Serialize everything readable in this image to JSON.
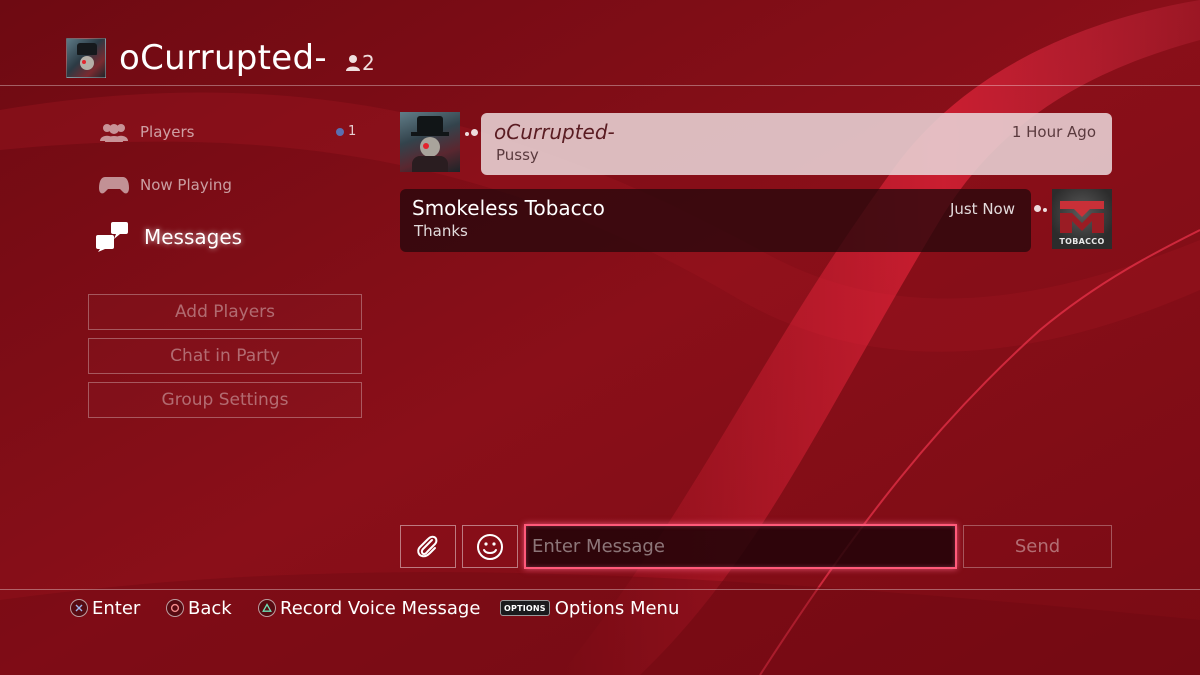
{
  "colors": {
    "background": "#7d0c15",
    "input_border": "#ff5a7a",
    "received_bubble": "#e8d4d6",
    "sent_bubble": "#26080b"
  },
  "header": {
    "title": "oCurrupted-",
    "member_count": "2",
    "member_icon": "person-icon"
  },
  "sidebar": {
    "items": [
      {
        "label": "Players",
        "icon": "players-icon",
        "badge": "1"
      },
      {
        "label": "Now Playing",
        "icon": "gamepad-icon"
      },
      {
        "label": "Messages",
        "icon": "messages-icon",
        "active": true
      }
    ],
    "buttons": [
      {
        "label": "Add Players"
      },
      {
        "label": "Chat in Party"
      },
      {
        "label": "Group Settings"
      }
    ]
  },
  "messages": [
    {
      "sender": "oCurrupted-",
      "time": "1 Hour Ago",
      "text": "Pussy",
      "direction": "received"
    },
    {
      "sender": "Smokeless Tobacco",
      "time": "Just Now",
      "text": "Thanks",
      "direction": "sent",
      "avatar_text": "TOBACCO"
    }
  ],
  "composer": {
    "placeholder": "Enter Message",
    "send_label": "Send",
    "attach_icon": "paperclip-icon",
    "emoji_icon": "smiley-icon"
  },
  "footer": {
    "hints": [
      {
        "glyph": "cross",
        "label": "Enter"
      },
      {
        "glyph": "circle",
        "label": "Back"
      },
      {
        "glyph": "triangle",
        "label": "Record Voice Message"
      },
      {
        "glyph": "options",
        "glyph_text": "OPTIONS",
        "label": "Options Menu"
      }
    ]
  }
}
